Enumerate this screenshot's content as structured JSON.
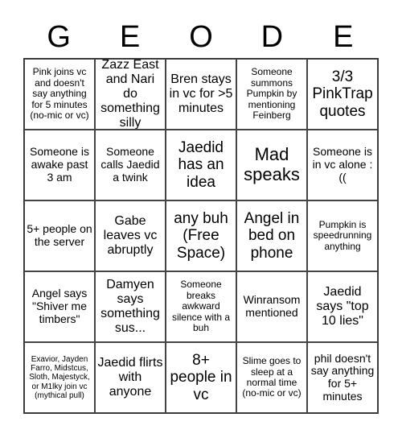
{
  "header": {
    "letters": [
      "G",
      "E",
      "O",
      "D",
      "E"
    ]
  },
  "board": {
    "free_space_index": 12,
    "cells": [
      "Pink joins vc and doesn't say anything for 5 minutes (no-mic or vc)",
      "Zazz East and Nari do something silly",
      "Bren stays in vc for >5 minutes",
      "Someone summons Pumpkin by mentioning Feinberg",
      "3/3 PinkTrap quotes",
      "Someone is awake past 3 am",
      "Someone calls Jaedid a twink",
      "Jaedid has an idea",
      "Mad speaks",
      "Someone is in vc alone :((",
      "5+ people on the server",
      "Gabe leaves vc abruptly",
      "any buh (Free Space)",
      "Angel in bed on phone",
      "Pumpkin is speedrunning anything",
      "Angel says \"Shiver me timbers\"",
      "Damyen says something sus...",
      "Someone breaks awkward silence with a buh",
      "Winransom mentioned",
      "Jaedid says \"top 10 lies\"",
      "Exavior, Jayden Farro, Midstcus, Sloth, Majestyck, or M1lky join vc (mythical pull)",
      "Jaedid flirts with anyone",
      "8+ people in vc",
      "Slime goes to sleep at a normal time (no-mic or vc)",
      "phil doesn't say anything for 5+ minutes"
    ]
  }
}
